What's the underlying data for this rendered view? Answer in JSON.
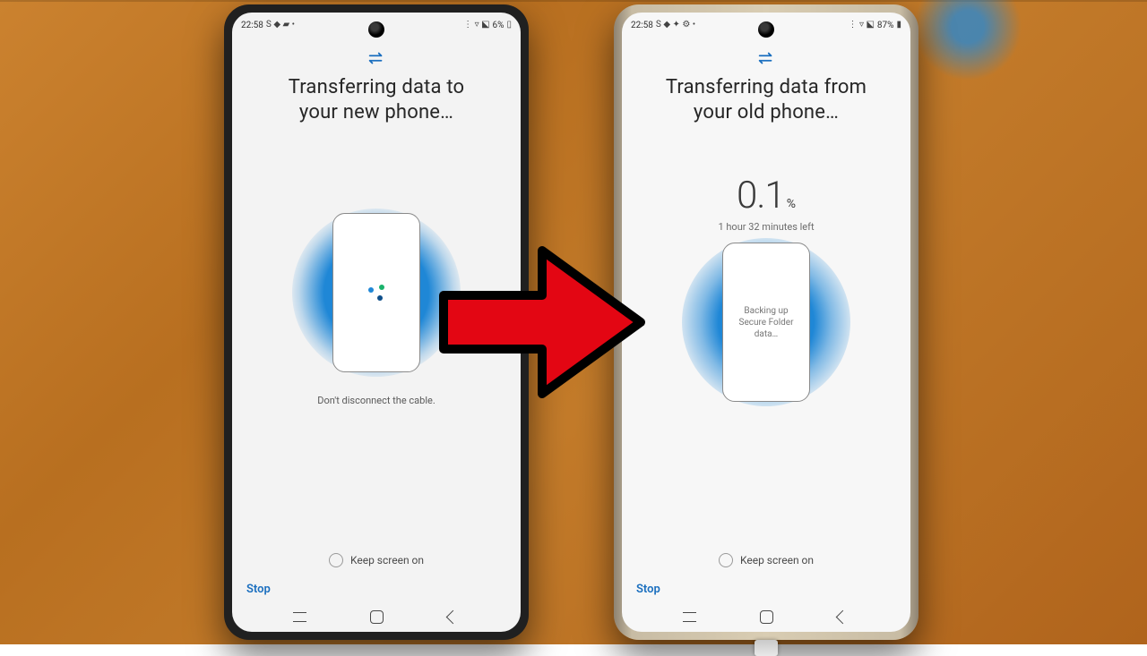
{
  "left": {
    "status": {
      "time": "22:58",
      "left_icons": "S ◆ ▰ •",
      "right_text": "6%",
      "right_icons": "⋮ ▿ ⬕"
    },
    "title_l1": "Transferring data to",
    "title_l2": "your new phone…",
    "subtitle": "Don't disconnect the cable.",
    "keep": "Keep screen on",
    "stop": "Stop"
  },
  "right": {
    "status": {
      "time": "22:58",
      "left_icons": "S ◆ ✦ ⚙ •",
      "right_text": "87%",
      "right_icons": "⋮ ▿ ⬕"
    },
    "title_l1": "Transferring data from",
    "title_l2": "your old phone…",
    "pct_value": "0.1",
    "pct_unit": "%",
    "eta": "1 hour 32 minutes left",
    "backup_l1": "Backing up",
    "backup_l2": "Secure Folder",
    "backup_l3": "data…",
    "keep": "Keep screen on",
    "stop": "Stop"
  }
}
